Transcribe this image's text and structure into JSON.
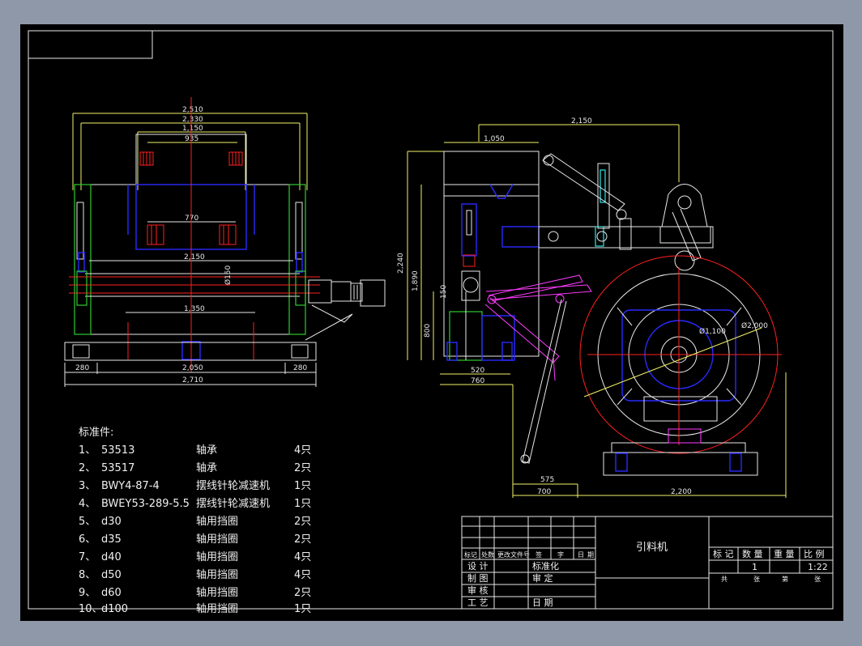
{
  "drawing_title": "引料机",
  "parts_list": {
    "heading": "标准件:",
    "items": [
      {
        "no": "1、",
        "code": "53513",
        "name": "轴承",
        "qty": "4只"
      },
      {
        "no": "2、",
        "code": "53517",
        "name": "轴承",
        "qty": "2只"
      },
      {
        "no": "3、",
        "code": "BWY4-87-4",
        "name": "摆线针轮减速机",
        "qty": "1只"
      },
      {
        "no": "4、",
        "code": "BWEY53-289-5.5",
        "name": "摆线针轮减速机",
        "qty": "1只"
      },
      {
        "no": "5、",
        "code": "d30",
        "name": "轴用挡圈",
        "qty": "2只"
      },
      {
        "no": "6、",
        "code": "d35",
        "name": "轴用挡圈",
        "qty": "2只"
      },
      {
        "no": "7、",
        "code": "d40",
        "name": "轴用挡圈",
        "qty": "4只"
      },
      {
        "no": "8、",
        "code": "d50",
        "name": "轴用挡圈",
        "qty": "4只"
      },
      {
        "no": "9、",
        "code": "d60",
        "name": "轴用挡圈",
        "qty": "2只"
      },
      {
        "no": "10、",
        "code": "d100",
        "name": "轴用挡圈",
        "qty": "1只"
      }
    ]
  },
  "title_block": {
    "rev_headers": [
      "标记",
      "处数",
      "更改文件号",
      "签",
      "字",
      "日",
      "期"
    ],
    "design": "设 计",
    "standardize": "标准化",
    "draw": "制 图",
    "approve_head": "审 定",
    "check": "审 核",
    "process": "工 艺",
    "date": "日 期",
    "mark_h": "标 记",
    "qty_h": "数 量",
    "weight_h": "重 量",
    "scale_h": "比 例",
    "qty_v": "1",
    "scale_v": "1:22",
    "total_l": "共",
    "sheets_l": "张",
    "page_l": "第",
    "sheet_l": "张"
  },
  "front_view_dims": {
    "d2510": "2,510",
    "d2330": "2,330",
    "d1150": "1,150",
    "d935": "935",
    "d770": "770",
    "d2150": "2,150",
    "d150": "Ø150",
    "d1350": "1,350",
    "d280a": "280",
    "d2050": "2,050",
    "d280b": "280",
    "d2710": "2,710"
  },
  "side_view_dims": {
    "d2150": "2,150",
    "d1050": "1,050",
    "d2240": "2,240",
    "d1890": "1,890",
    "d150": "150",
    "d800": "800",
    "d520": "520",
    "d760": "760",
    "d1100": "Ø1,100",
    "d2000": "Ø2,000",
    "d575": "575",
    "d700": "700",
    "d2200": "2,200"
  }
}
